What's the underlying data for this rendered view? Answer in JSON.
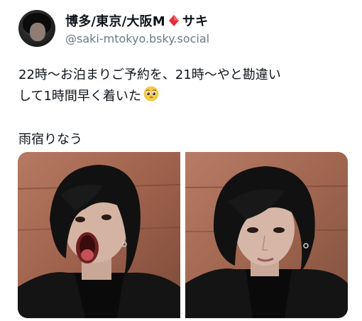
{
  "author": {
    "display_name_left": "博多/東京/大阪M",
    "display_name_right": "サキ",
    "handle": "@saki-mtokyo.bsky.social"
  },
  "post": {
    "line1": "22時〜お泊まりご予約を、21時〜やと勘違い",
    "line2": "して1時間早く着いた",
    "line3": "雨宿りなう"
  },
  "icons": {
    "diamond": "red-diamond-icon",
    "emoji": "pleading-face-icon"
  },
  "colors": {
    "diamond": "#e0303a",
    "handle_text": "#6b7a86"
  }
}
